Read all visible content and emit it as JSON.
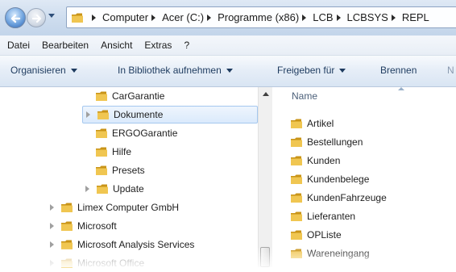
{
  "breadcrumb": [
    "Computer",
    "Acer (C:)",
    "Programme (x86)",
    "LCB",
    "LCBSYS",
    "REPL"
  ],
  "menu": [
    "Datei",
    "Bearbeiten",
    "Ansicht",
    "Extras",
    "?"
  ],
  "toolbar": {
    "organize": "Organisieren",
    "library": "In Bibliothek aufnehmen",
    "share": "Freigeben für",
    "burn": "Brennen",
    "more": "N"
  },
  "tree": [
    {
      "label": "CarGarantie",
      "expandable": false,
      "selected": false
    },
    {
      "label": "Dokumente",
      "expandable": true,
      "selected": true
    },
    {
      "label": "ERGOGarantie",
      "expandable": false,
      "selected": false
    },
    {
      "label": "Hilfe",
      "expandable": false,
      "selected": false
    },
    {
      "label": "Presets",
      "expandable": false,
      "selected": false
    },
    {
      "label": "Update",
      "expandable": true,
      "selected": false
    },
    {
      "label": "Limex Computer GmbH",
      "expandable": true,
      "selected": false
    },
    {
      "label": "Microsoft",
      "expandable": true,
      "selected": false
    },
    {
      "label": "Microsoft Analysis Services",
      "expandable": true,
      "selected": false
    },
    {
      "label": "Microsoft Office",
      "expandable": true,
      "selected": false
    }
  ],
  "content": {
    "column_name": "Name",
    "files": [
      "Artikel",
      "Bestellungen",
      "Kunden",
      "Kundenbelege",
      "KundenFahrzeuge",
      "Lieferanten",
      "OPListe",
      "Wareneingang"
    ]
  },
  "colors": {
    "folder": "#e9b93a",
    "folder_dark": "#c99418",
    "selection": "#dbeafc"
  }
}
